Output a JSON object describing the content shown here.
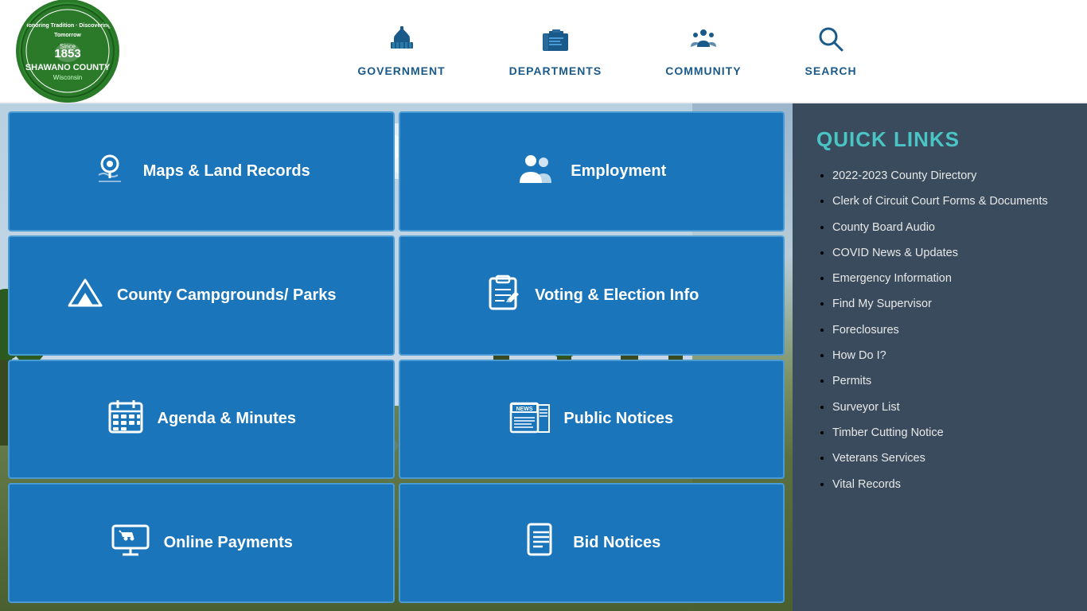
{
  "header": {
    "logo_alt": "Shawano County Wisconsin",
    "logo_since": "Since",
    "logo_year": "1853",
    "logo_name": "SHAWANO COUNTY",
    "logo_state": "Wisconsin",
    "nav": [
      {
        "id": "government",
        "label": "GOVERNMENT",
        "icon": "🏛"
      },
      {
        "id": "departments",
        "label": "DEPARTMENTS",
        "icon": "🏢"
      },
      {
        "id": "community",
        "label": "COMMUNITY",
        "icon": "👥"
      },
      {
        "id": "search",
        "label": "SEARCH",
        "icon": "🔍"
      }
    ]
  },
  "tiles": [
    {
      "id": "maps-land-records",
      "label": "Maps & Land Records",
      "icon": "📍"
    },
    {
      "id": "employment",
      "label": "Employment",
      "icon": "👤"
    },
    {
      "id": "county-campgrounds",
      "label": "County Campgrounds/ Parks",
      "icon": "⛺"
    },
    {
      "id": "voting-election",
      "label": "Voting & Election Info",
      "icon": "📋"
    },
    {
      "id": "agenda-minutes",
      "label": "Agenda & Minutes",
      "icon": "📅"
    },
    {
      "id": "public-notices",
      "label": "Public Notices",
      "icon": "📰"
    },
    {
      "id": "online-payments",
      "label": "Online Payments",
      "icon": "🖥"
    },
    {
      "id": "bid-notices",
      "label": "Bid Notices",
      "icon": "📄"
    }
  ],
  "quicklinks": {
    "title": "QUICK LINKS",
    "items": [
      {
        "id": "county-directory",
        "label": "2022-2023 County Directory"
      },
      {
        "id": "clerk-forms",
        "label": "Clerk of Circuit Court Forms & Documents"
      },
      {
        "id": "county-board-audio",
        "label": "County Board Audio"
      },
      {
        "id": "covid-news",
        "label": "COVID News & Updates"
      },
      {
        "id": "emergency-info",
        "label": "Emergency Information"
      },
      {
        "id": "find-supervisor",
        "label": "Find My Supervisor"
      },
      {
        "id": "foreclosures",
        "label": "Foreclosures"
      },
      {
        "id": "how-do-i",
        "label": "How Do I?"
      },
      {
        "id": "permits",
        "label": "Permits"
      },
      {
        "id": "surveyor-list",
        "label": "Surveyor List"
      },
      {
        "id": "timber-cutting",
        "label": "Timber Cutting Notice"
      },
      {
        "id": "veterans-services",
        "label": "Veterans Services"
      },
      {
        "id": "vital-records",
        "label": "Vital Records"
      }
    ]
  }
}
